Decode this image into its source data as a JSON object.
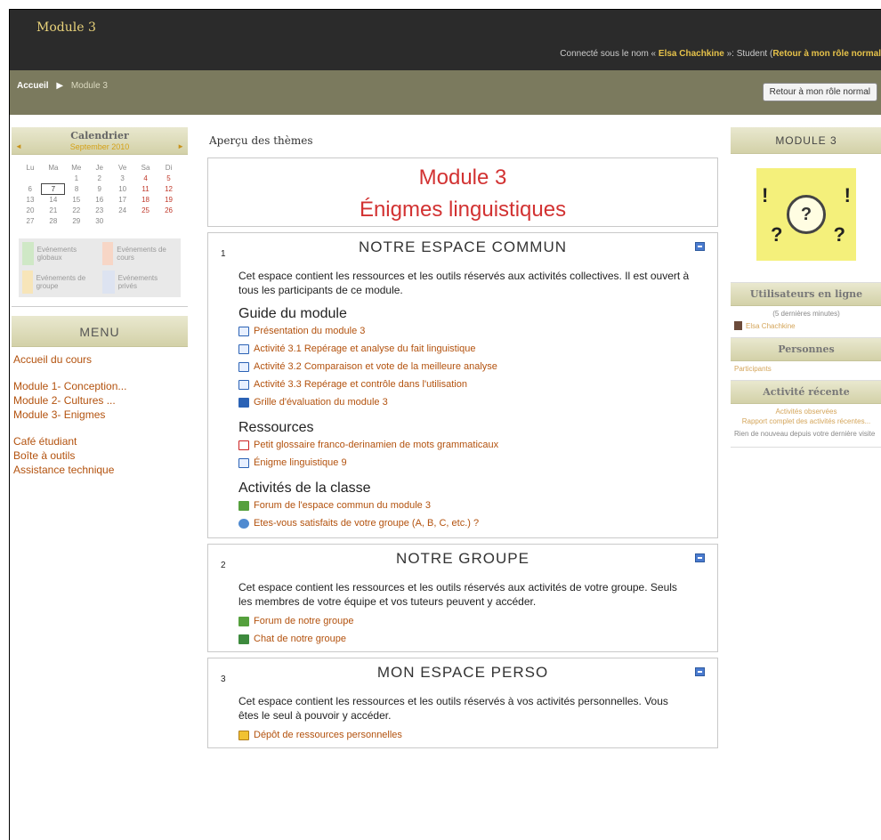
{
  "header": {
    "site_name": "Module 3",
    "login_prefix": "Connecté sous le nom « ",
    "user_name": "Elsa Chachkine",
    "login_mid": " »: Student (",
    "return_role_link": "Retour à mon rôle normal"
  },
  "navbar": {
    "home": "Accueil",
    "current": "Module 3",
    "role_button": "Retour à mon rôle normal"
  },
  "calendar": {
    "title": "Calendrier",
    "month": "September 2010",
    "prev": "◄",
    "next": "►",
    "weekdays": [
      "Lu",
      "Ma",
      "Me",
      "Je",
      "Ve",
      "Sa",
      "Di"
    ],
    "weeks": [
      [
        "",
        "",
        "1",
        "2",
        "3",
        "4",
        "5"
      ],
      [
        "6",
        "7",
        "8",
        "9",
        "10",
        "11",
        "12"
      ],
      [
        "13",
        "14",
        "15",
        "16",
        "17",
        "18",
        "19"
      ],
      [
        "20",
        "21",
        "22",
        "23",
        "24",
        "25",
        "26"
      ],
      [
        "27",
        "28",
        "29",
        "30",
        "",
        "",
        ""
      ]
    ],
    "today": "7",
    "legend": [
      {
        "label": "Evénements globaux",
        "color": "#cfe8c6"
      },
      {
        "label": "Evénements de cours",
        "color": "#f7d6c6"
      },
      {
        "label": "Evénements de groupe",
        "color": "#f7e5b9"
      },
      {
        "label": "Evénements privés",
        "color": "#dde3f1"
      }
    ]
  },
  "menu": {
    "title": "MENU",
    "items": [
      "Accueil du cours",
      "Module 1- Conception...",
      "Module 2- Cultures ...",
      "Module 3- Enigmes",
      "Café étudiant",
      "Boîte à outils",
      "Assistance technique"
    ]
  },
  "overview_title": "Aperçu des thèmes",
  "topic0": {
    "line1": "Module 3",
    "line2": "Énigmes linguistiques"
  },
  "sections": [
    {
      "num": "1",
      "title": "NOTRE ESPACE COMMUN",
      "desc": "Cet espace contient les ressources et les outils réservés aux activités collectives. Il est ouvert à tous les participants de ce module.",
      "groups": [
        {
          "heading": "Guide du module",
          "items": [
            {
              "label": "Présentation du module 3",
              "icon": "page"
            },
            {
              "label": "Activité 3.1 Repérage et analyse du fait linguistique",
              "icon": "page"
            },
            {
              "label": "Activité 3.2 Comparaison et vote de la meilleure analyse",
              "icon": "page"
            },
            {
              "label": "Activité 3.3 Repérage et contrôle dans l'utilisation",
              "icon": "page"
            },
            {
              "label": "Grille d'évaluation du module 3",
              "icon": "quiz"
            }
          ]
        },
        {
          "heading": "Ressources",
          "items": [
            {
              "label": "Petit glossaire franco-derinamien de mots grammaticaux",
              "icon": "pdf"
            },
            {
              "label": "Énigme linguistique 9",
              "icon": "page"
            }
          ]
        },
        {
          "heading": "Activités de la classe",
          "items": [
            {
              "label": "Forum de l'espace commun du module 3",
              "icon": "forum"
            },
            {
              "label": "Etes-vous satisfaits de votre groupe (A, B, C, etc.) ?",
              "icon": "choice"
            }
          ]
        }
      ]
    },
    {
      "num": "2",
      "title": "NOTRE GROUPE",
      "desc": "Cet espace contient les ressources et les outils réservés aux activités de votre groupe. Seuls les membres de votre équipe et vos tuteurs peuvent y accéder.",
      "groups": [
        {
          "heading": "",
          "items": [
            {
              "label": "Forum de notre groupe",
              "icon": "forum"
            },
            {
              "label": "Chat de notre groupe",
              "icon": "chat"
            }
          ]
        }
      ]
    },
    {
      "num": "3",
      "title": "MON ESPACE PERSO",
      "desc": "Cet espace contient les ressources et les outils réservés à vos activités personnelles. Vous êtes le seul à pouvoir y accéder.",
      "groups": [
        {
          "heading": "",
          "items": [
            {
              "label": "Dépôt de ressources personnelles",
              "icon": "upload"
            }
          ]
        }
      ]
    }
  ],
  "right": {
    "module_title": "MODULE 3",
    "online": {
      "title": "Utilisateurs en ligne",
      "sub": "(5 dernières minutes)",
      "user": "Elsa Chachkine"
    },
    "people": {
      "title": "Personnes",
      "link": "Participants"
    },
    "recent": {
      "title": "Activité récente",
      "observed": "Activités observées",
      "full_report": "Rapport complet des activités récentes...",
      "nothing": "Rien de nouveau depuis votre dernière visite"
    }
  }
}
